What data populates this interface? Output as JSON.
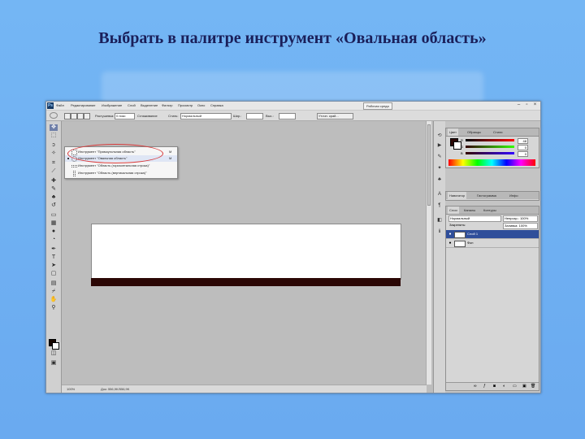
{
  "slide": {
    "title": "Выбрать в палитре инструмент «Овальная область»"
  },
  "menubar": {
    "logo": "Ps",
    "items": [
      "Файл",
      "Редактирование",
      "Изображение",
      "Слой",
      "Выделение",
      "Фильтр",
      "Просмотр",
      "Окно",
      "Справка"
    ],
    "workspace": "Рабочая среда"
  },
  "options": {
    "feather_label": "Растушевка:",
    "feather_value": "0 пикс",
    "antialias_label": "Сглаживание",
    "style_label": "Стиль:",
    "style_value": "Нормальный",
    "width_label": "Шир.:",
    "height_label": "Выс.:",
    "refine_label": "Уточн. край...",
    "palette_icon": "oval-marquee-icon"
  },
  "flyout": {
    "items": [
      {
        "label": "Инструмент \"Прямоугольная область\"",
        "key": "M",
        "selected": false
      },
      {
        "label": "Инструмент \"Овальная область\"",
        "key": "M",
        "selected": true
      },
      {
        "label": "Инструмент \"Область (горизонтальная строка)\"",
        "key": "",
        "selected": false
      },
      {
        "label": "Инструмент \"Область (вертикальная строка)\"",
        "key": "",
        "selected": false
      }
    ]
  },
  "colors_panel": {
    "tabs": [
      "Цвет",
      "Образцы",
      "Стили"
    ],
    "sliders": [
      {
        "label": "R",
        "value": "48"
      },
      {
        "label": "G",
        "value": "0"
      },
      {
        "label": "B",
        "value": "0"
      }
    ]
  },
  "nav_panel": {
    "tabs": [
      "Навигатор",
      "Гистограмма",
      "Инфо"
    ]
  },
  "layers_panel": {
    "tabs": [
      "Слои",
      "Каналы",
      "Контуры"
    ],
    "blend_mode": "Нормальный",
    "opacity_label": "Непрозр.: 100%",
    "lock_label": "Закрепить:",
    "fill_label": "Заливка: 100%",
    "layers": [
      {
        "name": "Слой 1",
        "selected": true
      },
      {
        "name": "Фон",
        "selected": false
      }
    ]
  },
  "statusbar": {
    "zoom": "100%",
    "doc_info": "Док: 556,9K/556,9K"
  },
  "colors": {
    "foreground": "#2b0705",
    "accent": "#2f4e9a",
    "highlight_ellipse": "#d83a3a"
  }
}
